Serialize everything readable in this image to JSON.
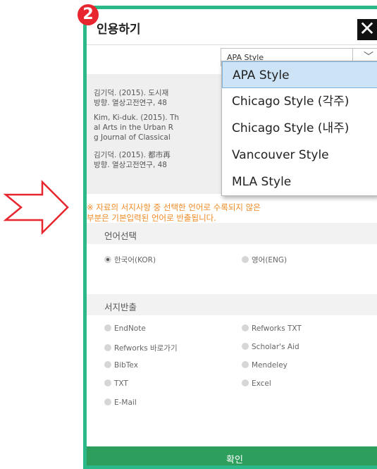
{
  "badge": "2",
  "dialog": {
    "title": "인용하기",
    "close_icon": "close-icon"
  },
  "style_select": {
    "value": "APA Style",
    "options": [
      "APA Style",
      "Chicago Style (각주)",
      "Chicago Style (내주)",
      "Vancouver Style",
      "MLA Style"
    ],
    "selected": "APA Style"
  },
  "citations": [
    [
      "김기덕. (2015). 도시재",
      "방향. 열상고전연구, 48"
    ],
    [
      "Kim, Ki-duk. (2015). Th",
      "al Arts in the Urban R",
      "g Journal of Classical"
    ],
    [
      "김기덕. (2015). 都市再",
      "방향. 열상고전연구, 48"
    ]
  ],
  "notice": [
    "※ 자료의 서지사항 중 선택한 언어로 수록되지 않은",
    "부분은 기본입력된 언어로 반출됩니다."
  ],
  "language": {
    "label": "언어선택",
    "options": [
      "한국어(KOR)",
      "영어(ENG)"
    ],
    "selected": "한국어(KOR)"
  },
  "export": {
    "label": "서지반출",
    "options": [
      "EndNote",
      "Refworks TXT",
      "Refworks 바로가기",
      "Scholar's Aid",
      "BibTex",
      "Mendeley",
      "TXT",
      "Excel",
      "E-Mail"
    ]
  },
  "confirm_label": "확인",
  "colors": {
    "frame": "#2bb98a",
    "badge": "#e8262f",
    "notice": "#f08a24",
    "confirm": "#2e9e5c",
    "dropdown_selected": "#cde4f7"
  }
}
